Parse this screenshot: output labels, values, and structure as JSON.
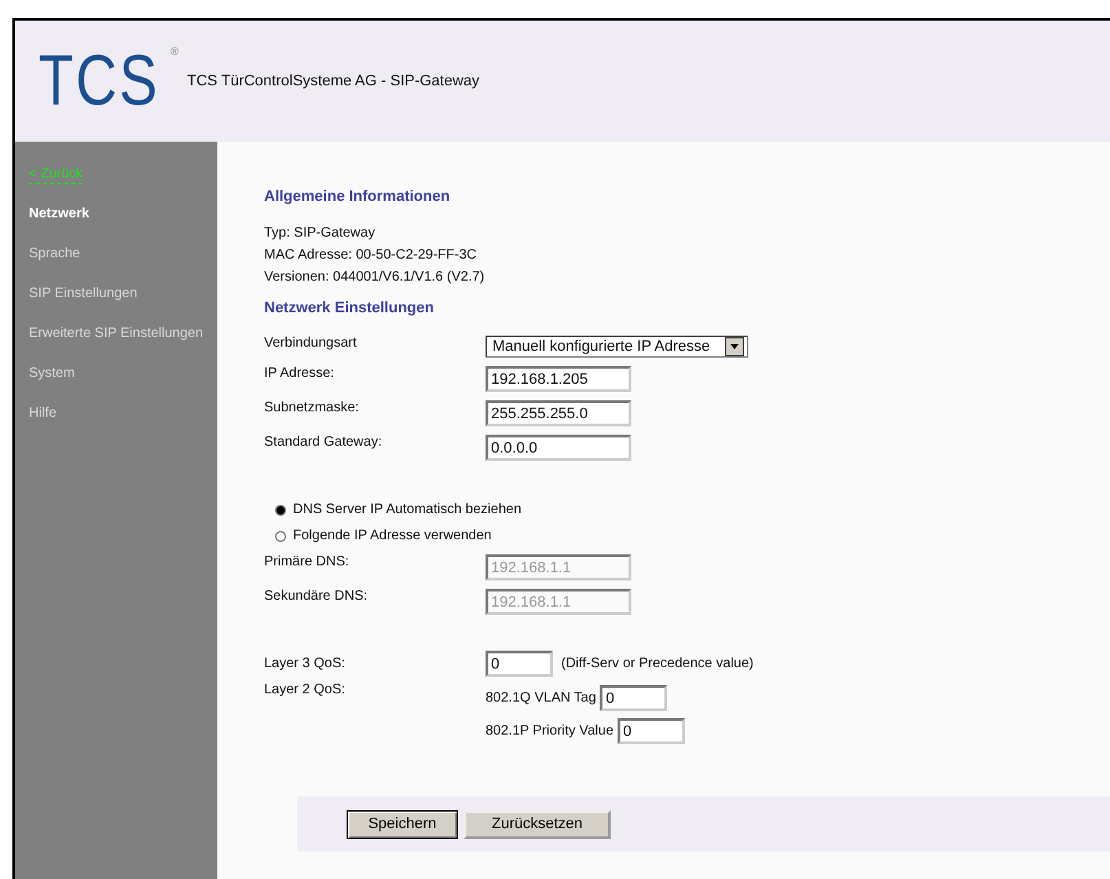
{
  "header": {
    "logo": "TCS",
    "logo_mark": "®",
    "title": "TCS TürControlSysteme AG - SIP-Gateway"
  },
  "sidebar": {
    "items": [
      {
        "label": "< Zurück",
        "kind": "back",
        "selected": false
      },
      {
        "label": "Netzwerk",
        "kind": "item",
        "selected": true
      },
      {
        "label": "Sprache",
        "kind": "item",
        "selected": false
      },
      {
        "label": "SIP Einstellungen",
        "kind": "item",
        "selected": false
      },
      {
        "label": "Erweiterte SIP Einstellungen",
        "kind": "item",
        "selected": false
      },
      {
        "label": "System",
        "kind": "item",
        "selected": false
      },
      {
        "label": "Hilfe",
        "kind": "item",
        "selected": false
      }
    ]
  },
  "general": {
    "heading": "Allgemeine Informationen",
    "lines": [
      "Typ: SIP-Gateway",
      "MAC Adresse: 00-50-C2-29-FF-3C",
      "Versionen: 044001/V6.1/V1.6 (V2.7)"
    ]
  },
  "network": {
    "heading": "Netzwerk Einstellungen",
    "connection": {
      "label": "Verbindungsart",
      "value": "Manuell konfigurierte IP Adresse"
    },
    "fields": [
      {
        "label": "IP Adresse:",
        "value": "192.168.1.205",
        "disabled": false
      },
      {
        "label": "Subnetzmaske:",
        "value": "255.255.255.0",
        "disabled": false
      },
      {
        "label": "Standard Gateway:",
        "value": "0.0.0.0",
        "disabled": false
      }
    ],
    "dns_options": [
      {
        "label": "DNS Server IP Automatisch beziehen",
        "selected": true
      },
      {
        "label": "Folgende IP Adresse verwenden",
        "selected": false
      }
    ],
    "dns_fields": [
      {
        "label": "Primäre DNS:",
        "value": "192.168.1.1",
        "disabled": true
      },
      {
        "label": "Sekundäre DNS:",
        "value": "192.168.1.1",
        "disabled": true
      }
    ],
    "layer3": {
      "label": "Layer 3 QoS:",
      "value": "0",
      "note": "(Diff-Serv or Precedence value)"
    },
    "layer2": {
      "label": "Layer 2 QoS:",
      "vlan_label": "802.1Q VLAN Tag",
      "vlan_value": "0",
      "priority_label": "802.1P Priority Value",
      "priority_value": "0"
    }
  },
  "buttons": [
    "Speichern",
    "Zurücksetzen"
  ]
}
